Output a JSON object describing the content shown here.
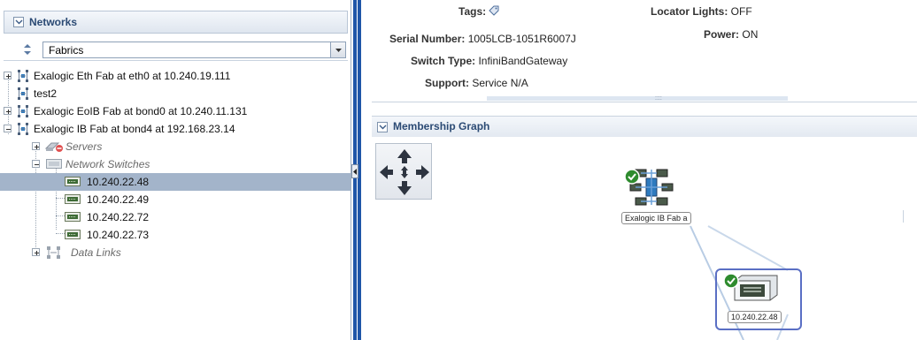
{
  "left_panel": {
    "title": "Networks",
    "selector": {
      "value": "Fabrics"
    },
    "tree": [
      {
        "label": "Exalogic Eth Fab at eth0 at 10.240.19.111",
        "expander": "plus"
      },
      {
        "label": "test2",
        "expander": "none"
      },
      {
        "label": "Exalogic EoIB Fab at bond0 at 10.240.11.131",
        "expander": "plus"
      },
      {
        "label": "Exalogic IB Fab at bond4 at 192.168.23.14",
        "expander": "minus"
      },
      {
        "label": "Servers",
        "expander": "plus"
      },
      {
        "label": "Network Switches",
        "expander": "minus"
      },
      {
        "label": "10.240.22.48",
        "selected": true
      },
      {
        "label": "10.240.22.49"
      },
      {
        "label": "10.240.22.72"
      },
      {
        "label": "10.240.22.73"
      },
      {
        "label": "Data Links",
        "expander": "plus"
      }
    ]
  },
  "details": {
    "tags_label": "Tags:",
    "serial_label": "Serial Number:",
    "serial_value": "1005LCB-1051R6007J",
    "switch_type_label": "Switch Type:",
    "switch_type_value": "InfiniBandGateway",
    "support_label": "Support:",
    "support_value": "Service N/A",
    "locator_label": "Locator Lights:",
    "locator_value": "OFF",
    "power_label": "Power:",
    "power_value": "ON",
    "scroll_grip": "::::"
  },
  "graph": {
    "title": "Membership Graph",
    "nodes": [
      {
        "caption": "Exalogic IB Fab a",
        "status": "ok"
      },
      {
        "caption": "10.240.22.48",
        "status": "ok"
      }
    ]
  },
  "colors": {
    "splitter": "#1f56a8",
    "selection": "#a3b4ca",
    "header_text": "#2b4a74",
    "status_ok": "#2e8b2e"
  }
}
